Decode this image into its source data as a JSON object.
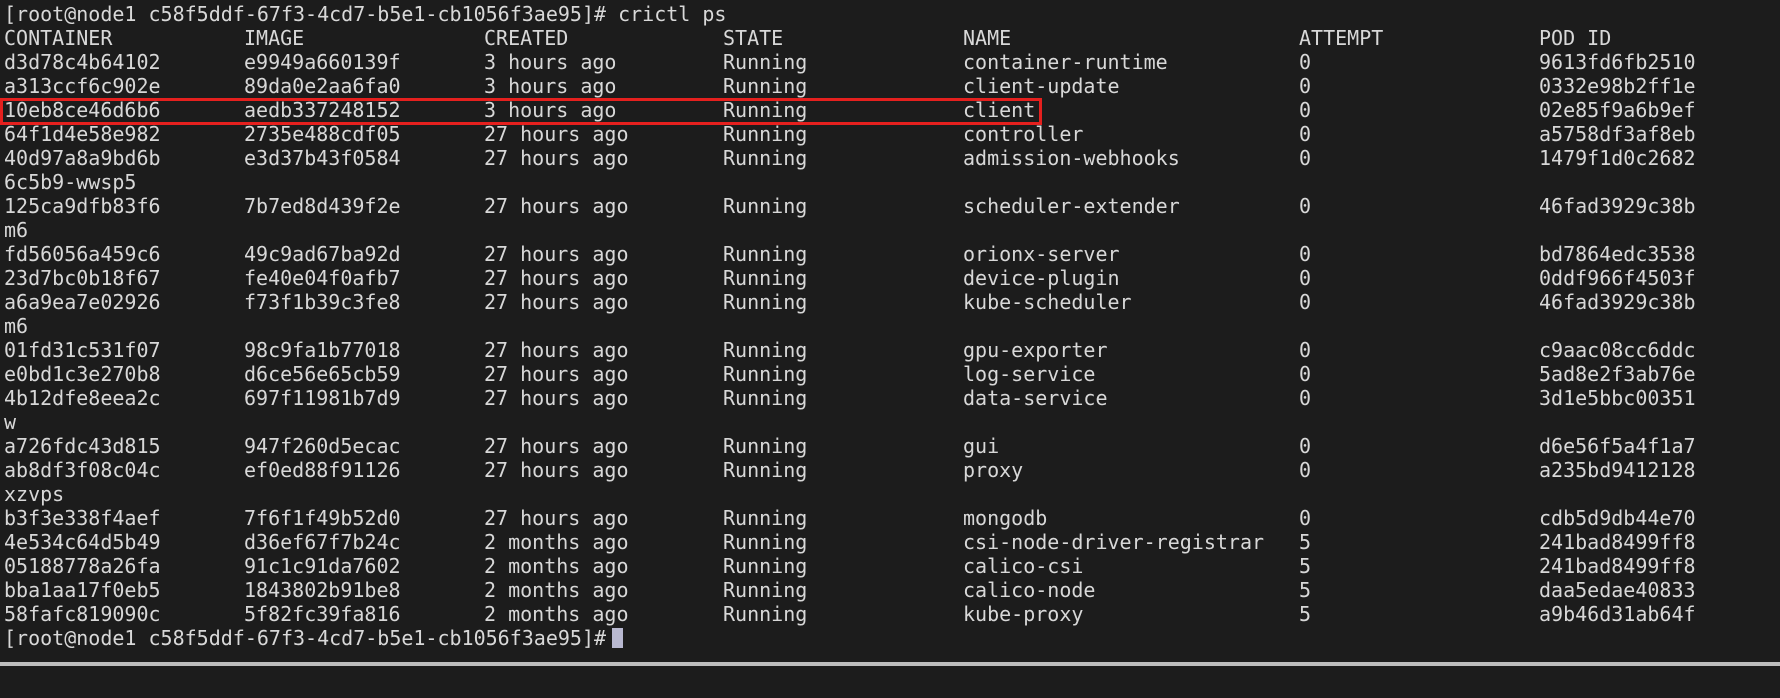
{
  "terminal": {
    "prompt_command": "[root@node1 c58f5ddf-67f3-4cd7-b5e1-cb1056f3ae95]# crictl ps",
    "final_prompt": "[root@node1 c58f5ddf-67f3-4cd7-b5e1-cb1056f3ae95]#",
    "colors": {
      "background": "#1c1c1c",
      "foreground": "#d8d8d8",
      "highlight_border": "#e5201e",
      "cursor": "#b8b8d0"
    }
  },
  "table": {
    "headers": [
      "CONTAINER",
      "IMAGE",
      "CREATED",
      "STATE",
      "NAME",
      "ATTEMPT",
      "POD ID"
    ],
    "rows": [
      {
        "container": "d3d78c4b64102",
        "image": "e9949a660139f",
        "created": "3 hours ago",
        "state": "Running",
        "name": "container-runtime",
        "attempt": "0",
        "pod_id": "9613fd6fb2510"
      },
      {
        "container": "a313ccf6c902e",
        "image": "89da0e2aa6fa0",
        "created": "3 hours ago",
        "state": "Running",
        "name": "client-update",
        "attempt": "0",
        "pod_id": "0332e98b2ff1e"
      },
      {
        "container": "10eb8ce46d6b6",
        "image": "aedb337248152",
        "created": "3 hours ago",
        "state": "Running",
        "name": "client",
        "attempt": "0",
        "pod_id": "02e85f9a6b9ef"
      },
      {
        "container": "64f1d4e58e982",
        "image": "2735e488cdf05",
        "created": "27 hours ago",
        "state": "Running",
        "name": "controller",
        "attempt": "0",
        "pod_id": "a5758df3af8eb"
      },
      {
        "container": "40d97a8a9bd6b",
        "image": "e3d37b43f0584",
        "created": "27 hours ago",
        "state": "Running",
        "name": "admission-webhooks",
        "attempt": "0",
        "pod_id": "1479f1d0c2682",
        "wrap": "6c5b9-wwsp5"
      },
      {
        "container": "125ca9dfb83f6",
        "image": "7b7ed8d439f2e",
        "created": "27 hours ago",
        "state": "Running",
        "name": "scheduler-extender",
        "attempt": "0",
        "pod_id": "46fad3929c38b",
        "wrap": "m6"
      },
      {
        "container": "fd56056a459c6",
        "image": "49c9ad67ba92d",
        "created": "27 hours ago",
        "state": "Running",
        "name": "orionx-server",
        "attempt": "0",
        "pod_id": "bd7864edc3538"
      },
      {
        "container": "23d7bc0b18f67",
        "image": "fe40e04f0afb7",
        "created": "27 hours ago",
        "state": "Running",
        "name": "device-plugin",
        "attempt": "0",
        "pod_id": "0ddf966f4503f"
      },
      {
        "container": "a6a9ea7e02926",
        "image": "f73f1b39c3fe8",
        "created": "27 hours ago",
        "state": "Running",
        "name": "kube-scheduler",
        "attempt": "0",
        "pod_id": "46fad3929c38b",
        "wrap": "m6"
      },
      {
        "container": "01fd31c531f07",
        "image": "98c9fa1b77018",
        "created": "27 hours ago",
        "state": "Running",
        "name": "gpu-exporter",
        "attempt": "0",
        "pod_id": "c9aac08cc6ddc"
      },
      {
        "container": "e0bd1c3e270b8",
        "image": "d6ce56e65cb59",
        "created": "27 hours ago",
        "state": "Running",
        "name": "log-service",
        "attempt": "0",
        "pod_id": "5ad8e2f3ab76e"
      },
      {
        "container": "4b12dfe8eea2c",
        "image": "697f11981b7d9",
        "created": "27 hours ago",
        "state": "Running",
        "name": "data-service",
        "attempt": "0",
        "pod_id": "3d1e5bbc00351",
        "wrap": "w"
      },
      {
        "container": "a726fdc43d815",
        "image": "947f260d5ecac",
        "created": "27 hours ago",
        "state": "Running",
        "name": "gui",
        "attempt": "0",
        "pod_id": "d6e56f5a4f1a7"
      },
      {
        "container": "ab8df3f08c04c",
        "image": "ef0ed88f91126",
        "created": "27 hours ago",
        "state": "Running",
        "name": "proxy",
        "attempt": "0",
        "pod_id": "a235bd9412128",
        "wrap": "xzvps"
      },
      {
        "container": "b3f3e338f4aef",
        "image": "7f6f1f49b52d0",
        "created": "27 hours ago",
        "state": "Running",
        "name": "mongodb",
        "attempt": "0",
        "pod_id": "cdb5d9db44e70"
      },
      {
        "container": "4e534c64d5b49",
        "image": "d36ef67f7b24c",
        "created": "2 months ago",
        "state": "Running",
        "name": "csi-node-driver-registrar",
        "attempt": "5",
        "pod_id": "241bad8499ff8"
      },
      {
        "container": "05188778a26fa",
        "image": "91c1c91da7602",
        "created": "2 months ago",
        "state": "Running",
        "name": "calico-csi",
        "attempt": "5",
        "pod_id": "241bad8499ff8"
      },
      {
        "container": "bba1aa17f0eb5",
        "image": "1843802b91be8",
        "created": "2 months ago",
        "state": "Running",
        "name": "calico-node",
        "attempt": "5",
        "pod_id": "daa5edae40833"
      },
      {
        "container": "58fafc819090c",
        "image": "5f82fc39fa816",
        "created": "2 months ago",
        "state": "Running",
        "name": "kube-proxy",
        "attempt": "5",
        "pod_id": "a9b46d31ab64f"
      }
    ]
  }
}
